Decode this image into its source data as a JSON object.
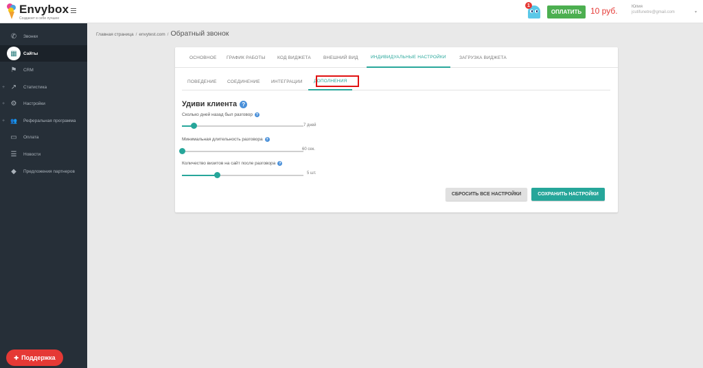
{
  "header": {
    "logo_name": "Envybox",
    "logo_tagline": "Создаюет в себе лучшее",
    "notification_count": "1",
    "pay_label": "ОПЛАТИТЬ",
    "balance": "10 руб.",
    "user_name": "Юлия",
    "user_email": "jcutifunetre@gmail.com",
    "user_caret": "▾"
  },
  "sidebar": {
    "items": [
      {
        "label": "Звонки",
        "icon": "phone-icon",
        "glyph": "✆",
        "plus": ""
      },
      {
        "label": "Сайты",
        "icon": "sites-icon",
        "glyph": "▦",
        "plus": ""
      },
      {
        "label": "CRM",
        "icon": "crm-icon",
        "glyph": "⚑",
        "plus": ""
      },
      {
        "label": "Статистика",
        "icon": "chart-icon",
        "glyph": "↗",
        "plus": "+"
      },
      {
        "label": "Настройки",
        "icon": "gear-icon",
        "glyph": "⚙",
        "plus": "+"
      },
      {
        "label": "Реферальная программа",
        "icon": "users-icon",
        "glyph": "👥",
        "plus": "+"
      },
      {
        "label": "Оплата",
        "icon": "card-icon",
        "glyph": "▭",
        "plus": ""
      },
      {
        "label": "Новости",
        "icon": "news-icon",
        "glyph": "☰",
        "plus": ""
      },
      {
        "label": "Предложения партнеров",
        "icon": "tag-icon",
        "glyph": "◆",
        "plus": ""
      }
    ],
    "support_label": "Поддержка",
    "support_glyph": "✚"
  },
  "breadcrumb": {
    "home": "Главная страница",
    "site": "envytest.com",
    "separator": "/",
    "current": "Обратный звонок"
  },
  "tabs": [
    "ОСНОВНОЕ",
    "ГРАФИК РАБОТЫ",
    "КОД ВИДЖЕТА",
    "ВНЕШНИЙ ВИД",
    "ИНДИВИДУАЛЬНЫЕ НАСТРОЙКИ",
    "ЗАГРУЗКА ВИДЖЕТА"
  ],
  "subtabs": [
    "ПОВЕДЕНИЕ",
    "СОЕДИНЕНИЕ",
    "ИНТЕГРАЦИИ",
    "ДОПОЛНЕНИЯ"
  ],
  "section": {
    "title": "Удиви клиента",
    "help": "?"
  },
  "fields": [
    {
      "label": "Сколько дней назад был разговор",
      "value": "7 дней",
      "fraction": 0.1
    },
    {
      "label": "Минимальная длительность разговора",
      "value": "60 сек.",
      "fraction": 0.0
    },
    {
      "label": "Количество визитов на сайт после разговора",
      "value": "5 шт.",
      "fraction": 0.29
    }
  ],
  "buttons": {
    "reset": "СБРОСИТЬ ВСЕ НАСТРОЙКИ",
    "save": "СОХРАНИТЬ НАСТРОЙКИ"
  },
  "colors": {
    "accent": "#26a69a",
    "sidebar": "#262f38",
    "pay": "#4caf50",
    "balance": "#e53935",
    "support": "#e53935",
    "highlight": "#e01010"
  }
}
